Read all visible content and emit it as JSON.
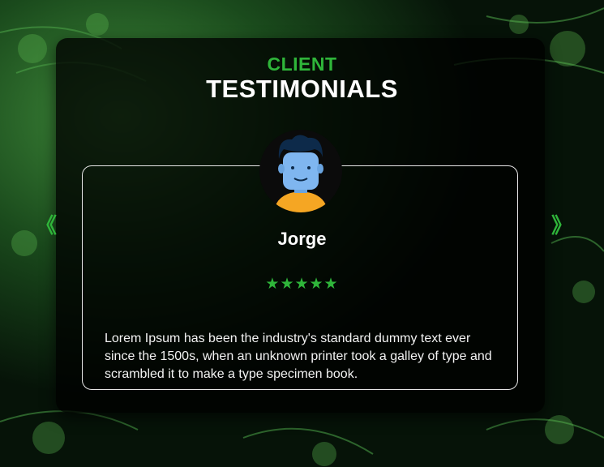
{
  "header": {
    "subtitle": "CLIENT",
    "title": "TESTIMONIALS"
  },
  "testimonial": {
    "name": "Jorge",
    "rating": 5,
    "stars": "★★★★★",
    "text": "Lorem Ipsum has been the industry's standard dummy text ever since the 1500s, when an unknown printer took a galley of type and scrambled it to make a type specimen book."
  },
  "nav": {
    "prev": "《",
    "next": "》"
  },
  "colors": {
    "accent": "#2fb53a",
    "text": "#ffffff",
    "avatar_skin": "#7fb6f0",
    "avatar_hair": "#0d2a4a",
    "avatar_shirt": "#f5a623"
  },
  "icons": {
    "avatar": "user-avatar-illustration",
    "prev": "chevron-double-left-icon",
    "next": "chevron-double-right-icon",
    "star": "star-icon"
  }
}
